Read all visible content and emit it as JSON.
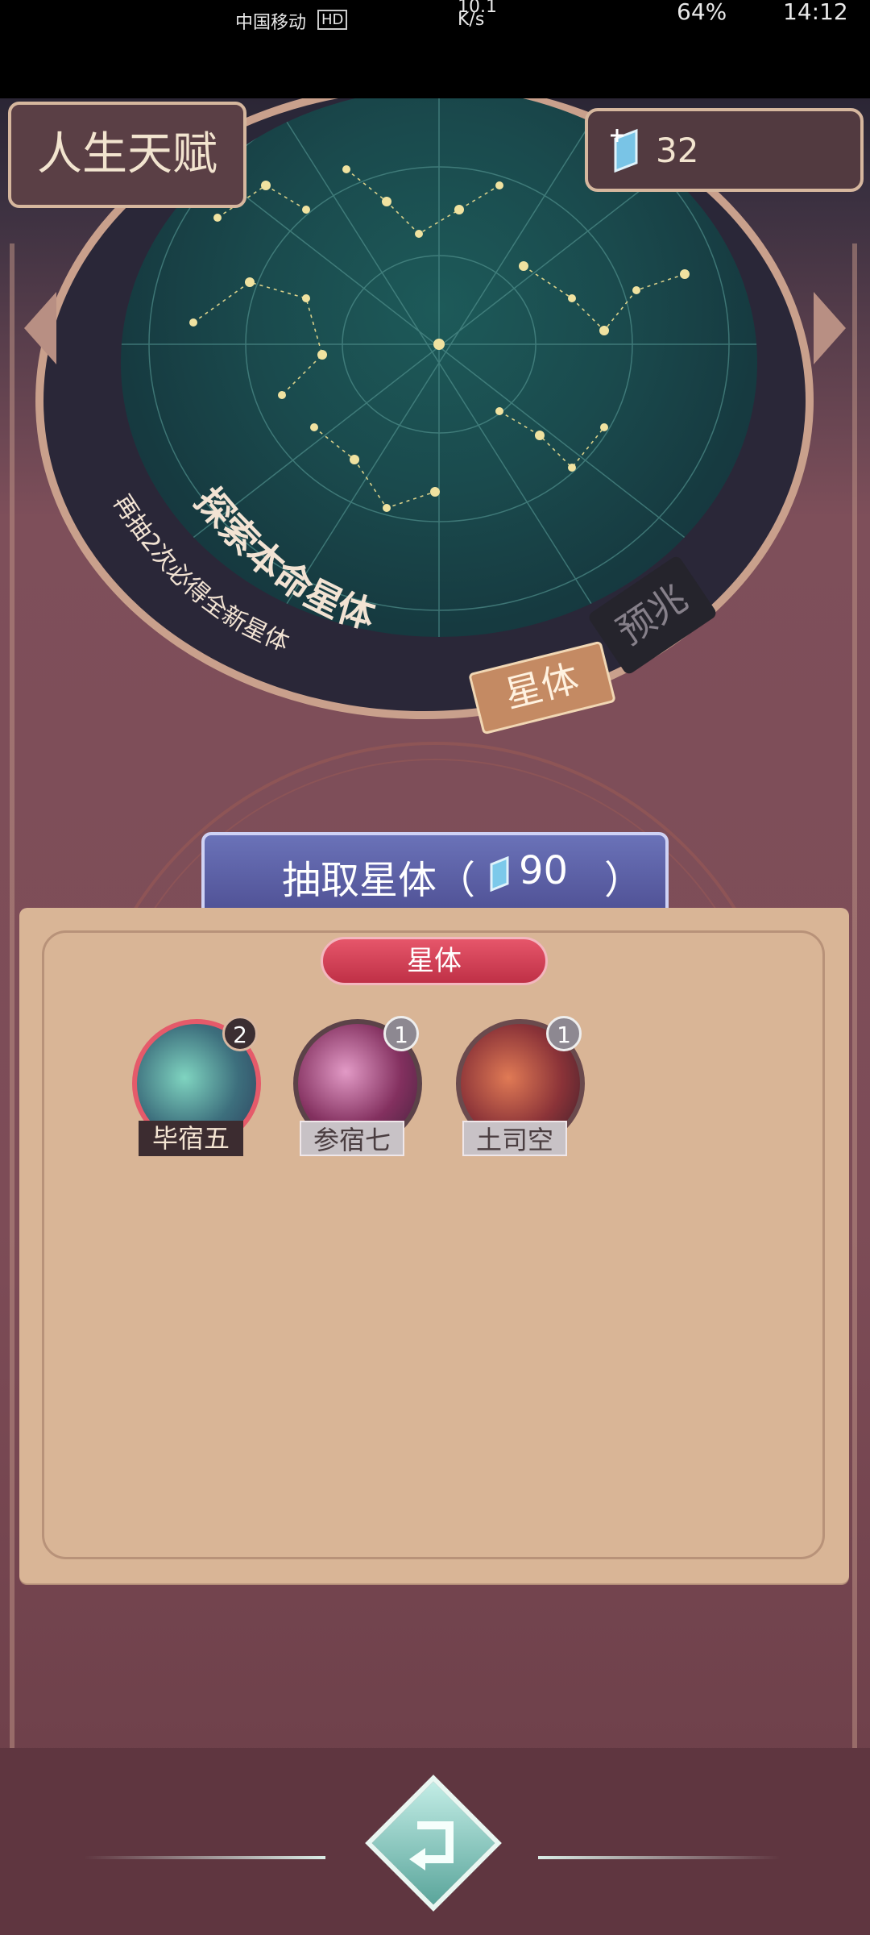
{
  "status_bar": {
    "carrier": "中国移动",
    "hd_badge": "HD",
    "net_speed": "10.1",
    "net_unit": "K/s",
    "battery": "64%",
    "time": "14:12"
  },
  "header": {
    "title": "人生天赋",
    "currency_value": "32"
  },
  "star_map": {
    "explore_text": "探索本命星体",
    "pity_hint": "再抽2次必得全新星体"
  },
  "mode_tabs": {
    "star": "星体",
    "omen": "预兆"
  },
  "draw_button": {
    "label": "抽取星体（",
    "cost": "90",
    "close": "）"
  },
  "panel": {
    "tab_label": "星体",
    "cards": [
      {
        "name": "毕宿五",
        "count": "2"
      },
      {
        "name": "参宿七",
        "count": "1"
      },
      {
        "name": "土司空",
        "count": "1"
      }
    ]
  },
  "colors": {
    "accent": "#d6b79e",
    "panel": "#d9b596",
    "tab_red": "#d94458",
    "draw_blue": "#5a5fa6"
  },
  "icons": [
    "crystal-icon",
    "back-arrow-icon"
  ]
}
